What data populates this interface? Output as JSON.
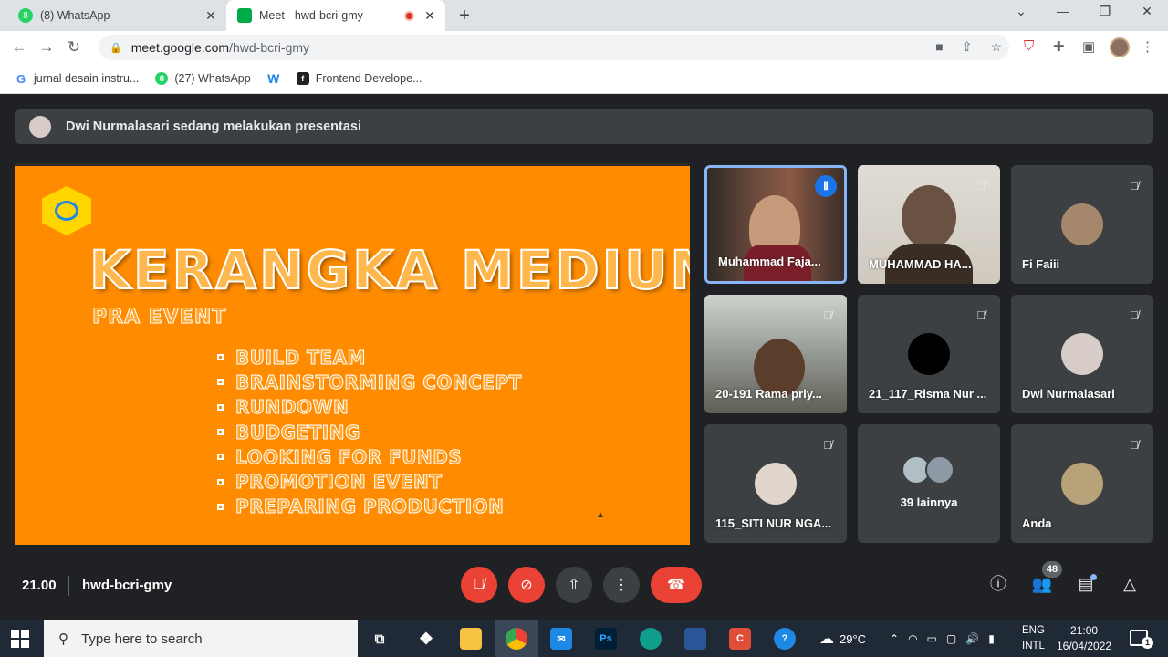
{
  "browser": {
    "tabs": [
      {
        "title": "(8) WhatsApp",
        "favicon_color": "#25d366",
        "favicon_text": "8"
      },
      {
        "title": "Meet - hwd-bcri-gmy",
        "favicon_color": "#00ac47"
      }
    ],
    "url_host": "meet.google.com",
    "url_path": "/hwd-bcri-gmy",
    "bookmarks": [
      {
        "label": "jurnal desain instru...",
        "icon": "google-icon",
        "color": "#4285f4"
      },
      {
        "label": "(27) WhatsApp",
        "icon": "whatsapp-icon",
        "color": "#25d366"
      },
      {
        "label": "",
        "icon": "w-logo-icon",
        "color": "#1e88e5"
      },
      {
        "label": "Frontend Develope...",
        "icon": "frontend-logo-icon",
        "color": "#202124"
      }
    ]
  },
  "meet": {
    "presenting_banner": "Dwi Nurmalasari sedang melakukan presentasi",
    "slide": {
      "title": "KERANGKA MEDIUM",
      "subtitle": "PRA EVENT",
      "bullets": [
        "BUILD TEAM",
        "BRAINSTORMING CONCEPT",
        "RUNDOWN",
        "BUDGETING",
        "LOOKING FOR FUNDS",
        "PROMOTION EVENT",
        "PREPARING PRODUCTION"
      ]
    },
    "participants": [
      {
        "name": "Muhammad Faja...",
        "type": "video",
        "speaking": true,
        "bg": "#5b4a3f"
      },
      {
        "name": "MUHAMMAD HA...",
        "type": "video",
        "speaking": false,
        "bg": "#d6d1c8"
      },
      {
        "name": "Fi Faiii",
        "type": "avatar",
        "speaking": false,
        "bg": "#a5876b"
      },
      {
        "name": "20-191 Rama priy...",
        "type": "video",
        "speaking": false,
        "bg": "#7a7b74"
      },
      {
        "name": "21_117_Risma Nur ...",
        "type": "avatar",
        "speaking": false,
        "bg": "#000000"
      },
      {
        "name": "Dwi Nurmalasari",
        "type": "avatar",
        "speaking": false,
        "bg": "#d7ccc8"
      },
      {
        "name": "115_SITI NUR NGA...",
        "type": "avatar",
        "speaking": false,
        "bg": "#e0d6cc"
      },
      {
        "name": "39 lainnya",
        "type": "others",
        "speaking": false,
        "bg": "#8d9aa6"
      },
      {
        "name": "Anda",
        "type": "avatar",
        "speaking": false,
        "bg": "#b8a27a"
      }
    ],
    "time": "21.00",
    "meeting_code": "hwd-bcri-gmy",
    "people_count": "48"
  },
  "taskbar": {
    "search_placeholder": "Type here to search",
    "weather": "29°C",
    "lang_top": "ENG",
    "lang_bottom": "INTL",
    "time": "21:00",
    "date": "16/04/2022",
    "notifications": "1"
  }
}
